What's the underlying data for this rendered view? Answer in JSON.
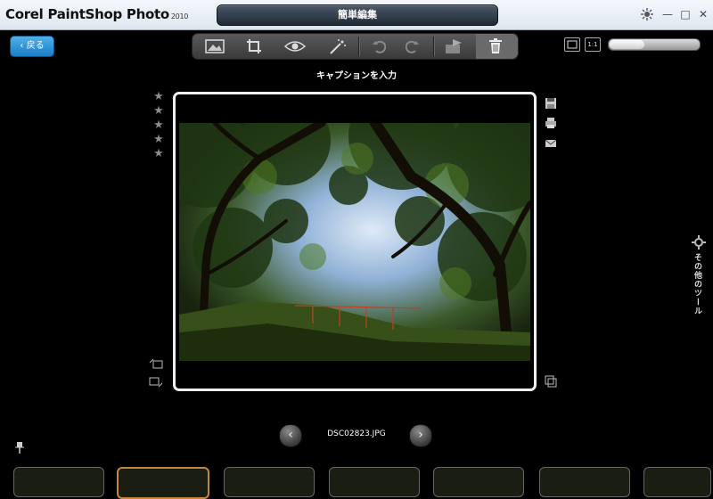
{
  "app": {
    "title": "Corel PaintShop Photo",
    "version": "2010"
  },
  "mode_title": "簡単編集",
  "window_controls": {
    "minimize": "—",
    "maximize": "□",
    "close": "✕"
  },
  "toolbar": {
    "back_label": "戻る",
    "tools": [
      "photo-fix-icon",
      "crop-icon",
      "red-eye-icon",
      "makeover-icon",
      "rotate-left-icon",
      "rotate-right-icon",
      "share-icon",
      "trash-icon"
    ],
    "actual_size_label": "1:1"
  },
  "caption_placeholder": "キャプションを入力",
  "rating": {
    "stars": 5,
    "value": 0
  },
  "right_sidebar": {
    "other_tools_label": "その他のツール",
    "icons": [
      "save-icon",
      "print-icon",
      "email-icon",
      "compare-icon"
    ]
  },
  "navigation": {
    "filename": "DSC02823.JPG",
    "prev": "‹",
    "next": "›"
  },
  "filmstrip": {
    "count": 7,
    "selected_index": 1
  },
  "zoom": {
    "level_fraction": 0.38
  }
}
